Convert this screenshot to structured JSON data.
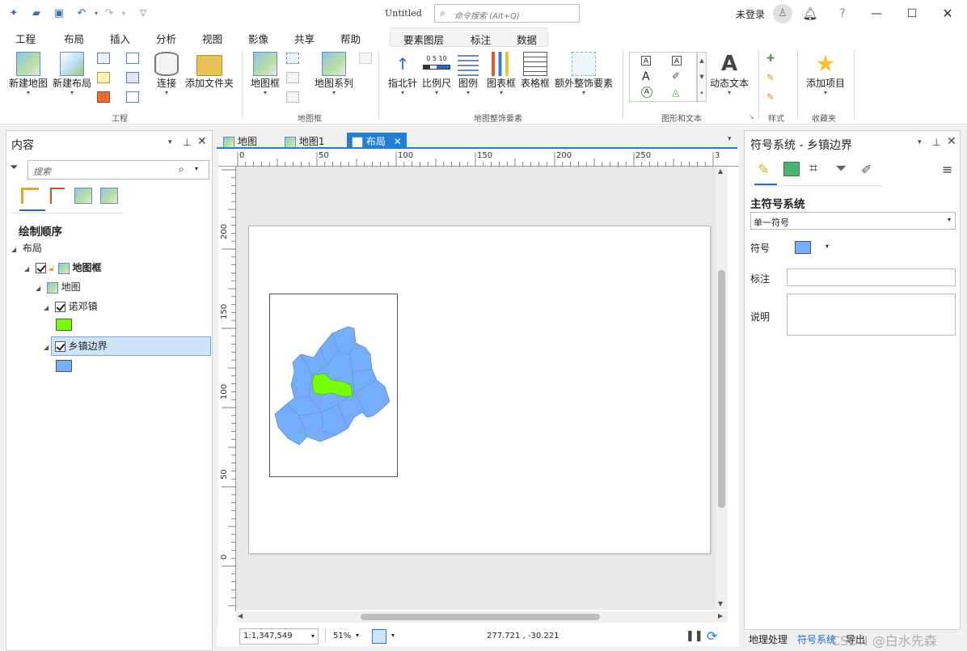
{
  "titlebar": {
    "title": "Untitled",
    "search_placeholder": "命令搜索 (Alt+Q)",
    "login": "未登录"
  },
  "menu": {
    "items": [
      "工程",
      "布局",
      "插入",
      "分析",
      "视图",
      "影像",
      "共享",
      "帮助"
    ],
    "active": "插入",
    "context_tabs": [
      "要素图层",
      "标注",
      "数据"
    ]
  },
  "ribbon": {
    "project": {
      "new_map": "新建地图",
      "new_layout": "新建布局",
      "connect": "连接",
      "add_folder": "添加文件夹",
      "group": "工程"
    },
    "mapframe": {
      "map_frame": "地图框",
      "map_series": "地图系列",
      "group": "地图框"
    },
    "surround": {
      "north_arrow": "指北针",
      "scale_bar": "比例尺",
      "legend": "图例",
      "chart_frame": "图表框",
      "table_frame": "表格框",
      "extra": "额外整饰要素",
      "group": "地图整饰要素",
      "scale_ticks": "0  5  10"
    },
    "graphics": {
      "dynamic_text": "动态文本",
      "group": "图形和文本"
    },
    "styles": {
      "group": "样式"
    },
    "favorites": {
      "add_item": "添加项目",
      "group": "收藏夹"
    }
  },
  "contents": {
    "title": "内容",
    "search_placeholder": "搜索",
    "drawing_order": "绘制顺序",
    "tree": {
      "layout": "布局",
      "map_frame": "地图框",
      "map": "地图",
      "layer1": "诺邓镇",
      "layer2": "乡镇边界"
    },
    "layer1_color": "#76ff03",
    "layer2_color": "#76adf8"
  },
  "tabs": {
    "items": [
      "地图",
      "地图1",
      "布局"
    ],
    "active": "布局"
  },
  "ruler": {
    "top": [
      "0",
      "50",
      "100",
      "150",
      "200",
      "250",
      "3"
    ],
    "left": [
      "200",
      "150",
      "100",
      "50",
      "0"
    ]
  },
  "statusbar": {
    "scale": "1:1,347,549",
    "zoom": "51%",
    "coords": "277.721 , -30.221"
  },
  "symbology": {
    "title": "符号系统 - 乡镇边界",
    "primary": "主符号系统",
    "primary_value": "单一符号",
    "symbol_label": "符号",
    "label_label": "标注",
    "desc_label": "说明",
    "symbol_color": "#76adf8"
  },
  "bottom_tabs": {
    "geoprocessing": "地理处理",
    "symbology": "符号系统",
    "export": "导出"
  },
  "watermark": "CSDN @白水先森"
}
